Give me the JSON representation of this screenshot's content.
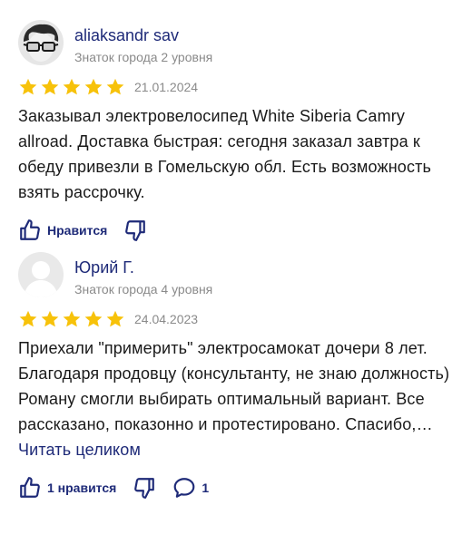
{
  "reviews": [
    {
      "author": "aliaksandr sav",
      "level": "Знаток города 2 уровня",
      "rating": 5,
      "date": "21.01.2024",
      "text": "Заказывал электровелосипед White Siberia Camry allroad. Доставка быстрая: сегодня заказал завтра к обеду привезли в Гомельскую обл. Есть возможность взять рассрочку.",
      "like_label": "Нравится",
      "avatar_icon": "avatar-with-glasses-icon"
    },
    {
      "author": "Юрий Г.",
      "level": "Знаток города 4 уровня",
      "rating": 5,
      "date": "24.04.2023",
      "text": "Приехали \"примерить\" электросамокат дочери 8 лет. Благодаря продовцу (консультанту, не знаю должность) Роману смогли выбирать оптимальный вариант. Все рассказано, показонно и протестировано. Спасибо,…",
      "read_more": "Читать целиком",
      "like_label": "1 нравится",
      "comment_count": "1",
      "avatar_icon": "default-avatar-icon"
    }
  ],
  "colors": {
    "star": "#f7c20a",
    "link": "#1e2a78",
    "muted": "#8a8a8a"
  }
}
